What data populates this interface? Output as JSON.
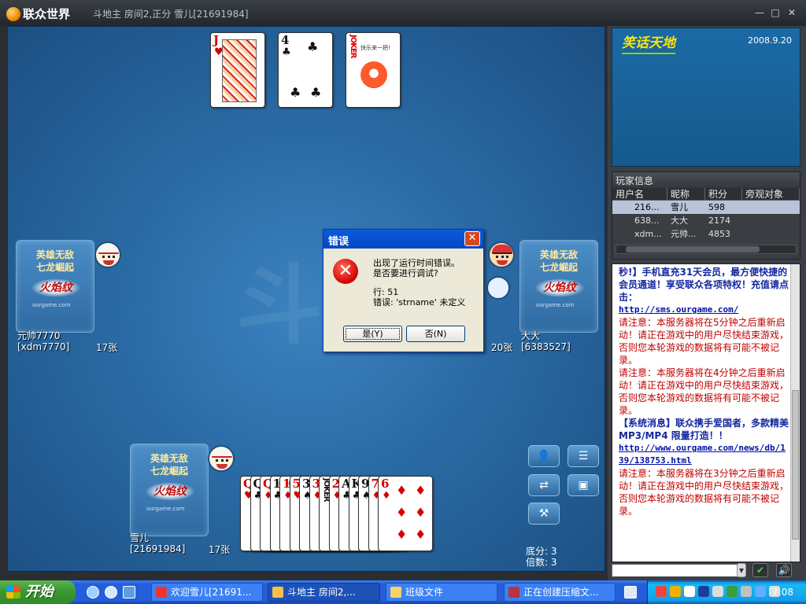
{
  "window": {
    "brand": "联众世界",
    "caption": "斗地主 房间2,正分 雪儿[21691984]",
    "minimize_label": "—",
    "maximize_label": "□",
    "close_label": "✕"
  },
  "table": {
    "watermark": "斗地",
    "bottom_cards": [
      {
        "rank": "J",
        "suit": "♥",
        "color": "red",
        "type": "face"
      },
      {
        "rank": "4",
        "suit": "♣",
        "color": "black",
        "type": "number"
      },
      {
        "rank": "JOKER",
        "suit": "",
        "color": "red",
        "type": "joker",
        "caption": "快乐来一把!"
      }
    ],
    "players": {
      "left": {
        "name": "元帅7770",
        "id": "[xdm7770]",
        "count": "17张",
        "slogan1": "英雄无敌",
        "slogan2": "七龙崛起",
        "logo": "火焰纹",
        "site": "ourgame.com"
      },
      "right": {
        "name": "大大",
        "id": "[6383527]",
        "count": "20张",
        "slogan1": "英雄无敌",
        "slogan2": "七龙崛起",
        "logo": "火焰纹",
        "site": "ourgame.com"
      },
      "self": {
        "name": "雪儿",
        "id": "[21691984]",
        "count": "17张",
        "slogan1": "英雄无敌",
        "slogan2": "七龙崛起",
        "logo": "火焰纹",
        "site": "ourgame.com"
      }
    },
    "hand": [
      {
        "rank": "Q",
        "suit": "♥",
        "color": "red"
      },
      {
        "rank": "Q",
        "suit": "♣",
        "color": "black"
      },
      {
        "rank": "Q",
        "suit": "♦",
        "color": "red"
      },
      {
        "rank": "10",
        "suit": "♣",
        "color": "black"
      },
      {
        "rank": "10",
        "suit": "♦",
        "color": "red"
      },
      {
        "rank": "5",
        "suit": "♥",
        "color": "red"
      },
      {
        "rank": "3",
        "suit": "♠",
        "color": "black"
      },
      {
        "rank": "3",
        "suit": "♦",
        "color": "red"
      },
      {
        "rank": "JOKER",
        "suit": "",
        "color": "black"
      },
      {
        "rank": "2",
        "suit": "♦",
        "color": "red"
      },
      {
        "rank": "A",
        "suit": "♣",
        "color": "black"
      },
      {
        "rank": "K",
        "suit": "♣",
        "color": "black"
      },
      {
        "rank": "9",
        "suit": "♠",
        "color": "black"
      },
      {
        "rank": "7",
        "suit": "♦",
        "color": "red"
      },
      {
        "rank": "6",
        "suit": "♦",
        "color": "red"
      }
    ],
    "base_score": "底分: 3",
    "multiplier": "倍数: 3"
  },
  "dialog": {
    "title": "错误",
    "line1": "出现了运行时间错误。",
    "line2": "是否要进行调试?",
    "line3": "行: 51",
    "line4": "错误: 'strname' 未定义",
    "yes": "是(Y)",
    "no": "否(N)"
  },
  "right": {
    "joke_title": "笑话天地",
    "joke_date": "2008.9.20",
    "player_info_title": "玩家信息",
    "columns": [
      "用户名",
      "昵称",
      "积分",
      "旁观对象"
    ],
    "rows": [
      {
        "user": "216...",
        "nick": "雪儿",
        "score": "598",
        "watch": ""
      },
      {
        "user": "638...",
        "nick": "大大",
        "score": "2174",
        "watch": ""
      },
      {
        "user": "xdm...",
        "nick": "元帅...",
        "score": "4853",
        "watch": ""
      }
    ],
    "chat": [
      {
        "type": "sys",
        "text": "秒!】手机直充31天会员，最方便快捷的会员通道！享受联众各项特权！充值请点击："
      },
      {
        "type": "link",
        "text": "http://sms.ourgame.com/"
      },
      {
        "type": "warn",
        "text": "请注意：本服务器将在5分钟之后重新启动！请正在游戏中的用户尽快结束游戏，否则您本轮游戏的数据将有可能不被记录。"
      },
      {
        "type": "warn",
        "text": "请注意：本服务器将在4分钟之后重新启动！请正在游戏中的用户尽快结束游戏，否则您本轮游戏的数据将有可能不被记录。"
      },
      {
        "type": "sys",
        "text": "【系统消息】联众携手爱国者，多款精美MP3/MP4 限量打造！！"
      },
      {
        "type": "link",
        "text": "http://www.ourgame.com/news/db/139/138753.html"
      },
      {
        "type": "warn",
        "text": "请注意：本服务器将在3分钟之后重新启动！请正在游戏中的用户尽快结束游戏，否则您本轮游戏的数据将有可能不被记录。"
      }
    ],
    "chat_placeholder": ""
  },
  "taskbar": {
    "start": "开始",
    "tasks": [
      "欢迎雪儿[21691...",
      "斗地主 房间2,...",
      "班级文件",
      "正在创建压缩文..."
    ],
    "clock": "7:08"
  }
}
